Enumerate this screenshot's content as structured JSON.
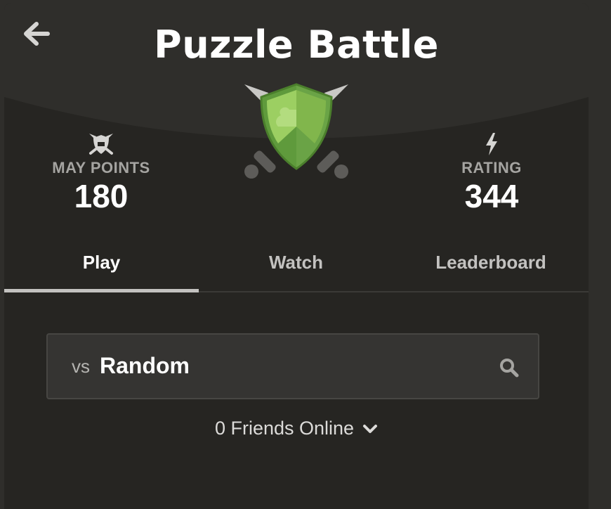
{
  "header": {
    "title": "Puzzle Battle",
    "back_icon": "arrow-left-icon",
    "emblem_icon": "puzzle-shield-crossed-swords-icon"
  },
  "stats": {
    "points": {
      "label": "MAY POINTS",
      "value": "180",
      "icon": "shield-swords-icon"
    },
    "rating": {
      "label": "RATING",
      "value": "344",
      "icon": "lightning-bolt-icon"
    }
  },
  "tabs": [
    {
      "label": "Play",
      "active": true
    },
    {
      "label": "Watch",
      "active": false
    },
    {
      "label": "Leaderboard",
      "active": false
    }
  ],
  "opponent": {
    "prefix": "vs",
    "value": "Random",
    "icon": "search-icon"
  },
  "friends": {
    "label": "0 Friends Online",
    "icon": "chevron-down-icon"
  },
  "colors": {
    "background": "#262522",
    "header_band": "#2f2e2b",
    "shield_green": "#81b64c",
    "text_muted": "#a5a4a1"
  }
}
